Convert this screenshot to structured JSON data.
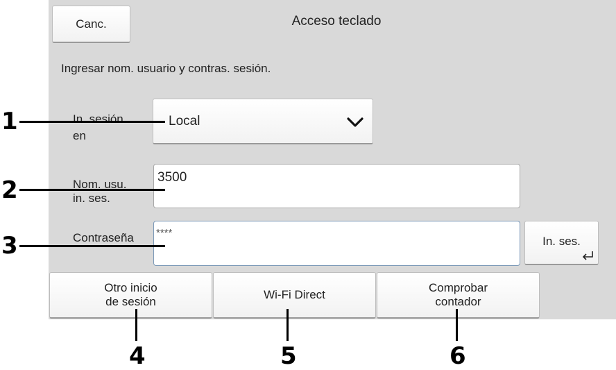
{
  "header": {
    "cancel_label": "Canc.",
    "title": "Acceso teclado"
  },
  "instruction": "Ingresar nom. usuario y contras. sesión.",
  "login_to": {
    "label_line1": "In. sesión",
    "label_line2": "en",
    "selected": "Local"
  },
  "username": {
    "label_line1": "Nom. usu.",
    "label_line2": "in. ses.",
    "value": "3500"
  },
  "password": {
    "label": "Contraseña",
    "value": "****"
  },
  "login_button": {
    "label": "In. ses."
  },
  "bottom_buttons": {
    "other_login_line1": "Otro inicio",
    "other_login_line2": "de sesión",
    "wifi_direct": "Wi-Fi Direct",
    "check_counter_line1": "Comprobar",
    "check_counter_line2": "contador"
  },
  "callouts": [
    "1",
    "2",
    "3",
    "4",
    "5",
    "6"
  ]
}
